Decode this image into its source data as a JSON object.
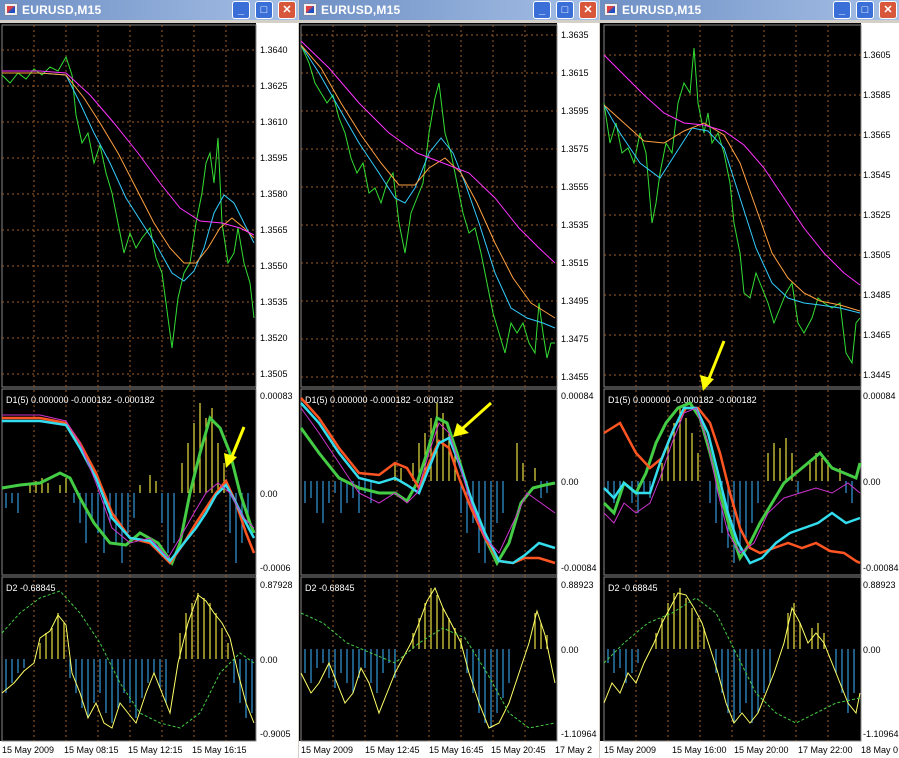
{
  "windows": [
    {
      "title": "EURUSD,M15",
      "price_ticks": [
        "1.3640",
        "1.3625",
        "1.3610",
        "1.3595",
        "1.3580",
        "1.3565",
        "1.3550",
        "1.3535",
        "1.3520",
        "1.3505"
      ],
      "d1_label": "D1(5) 0.000000 -0.000182 -0.000182",
      "d1_ticks": [
        "0.00083",
        "0.00",
        "-0.0006"
      ],
      "d2_label": "D2 -0.68845",
      "d2_ticks": [
        "0.87928",
        "0.00",
        "-0.9005"
      ],
      "dates": [
        "15 May 2009",
        "15 May 08:15",
        "15 May 12:15",
        "15 May 16:15"
      ]
    },
    {
      "title": "EURUSD,M15",
      "price_ticks": [
        "1.3635",
        "1.3615",
        "1.3595",
        "1.3575",
        "1.3555",
        "1.3535",
        "1.3515",
        "1.3495",
        "1.3475",
        "1.3455"
      ],
      "d1_label": "D1(5) 0.000000 -0.000182 -0.000182",
      "d1_ticks": [
        "0.00084",
        "0.00",
        "-0.00084"
      ],
      "d2_label": "D2 -0.68845",
      "d2_ticks": [
        "0.88923",
        "0.00",
        "-1.10964"
      ],
      "dates": [
        "15 May 2009",
        "15 May 12:45",
        "15 May 16:45",
        "15 May 20:45",
        "17 May 2"
      ]
    },
    {
      "title": "EURUSD,M15",
      "price_ticks": [
        "1.3605",
        "1.3585",
        "1.3565",
        "1.3545",
        "1.3525",
        "1.3505",
        "1.3485",
        "1.3465",
        "1.3445"
      ],
      "d1_label": "D1(5) 0.000000 -0.000182 -0.000182",
      "d1_ticks": [
        "0.00084",
        "0.00",
        "-0.00084"
      ],
      "d2_label": "D2 -0.68845",
      "d2_ticks": [
        "0.88923",
        "0.00",
        "-1.10964"
      ],
      "dates": [
        "15 May 2009",
        "15 May 16:00",
        "15 May 20:00",
        "17 May 22:00",
        "18 May 0"
      ]
    }
  ],
  "buttons": {
    "minimize": "_",
    "maximize": "□",
    "close": "✕"
  },
  "colors": {
    "price": "#33dd33",
    "ma_fast": "#33ccff",
    "ma_mid": "#ffa040",
    "ma_slow": "#ff33ff",
    "hist_pos": "#e8e040",
    "hist_neg": "#3399dd",
    "arrow": "#ffff00",
    "grid": "#a0602a"
  }
}
